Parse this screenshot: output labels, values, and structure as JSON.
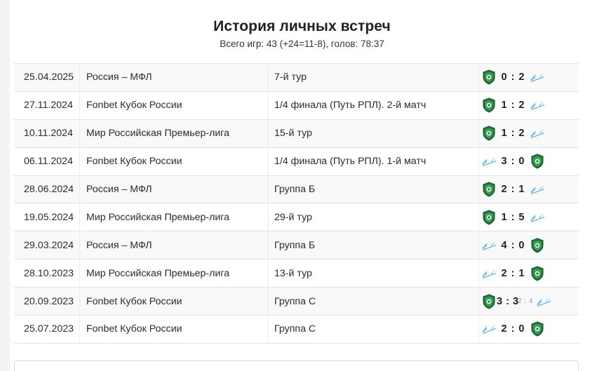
{
  "header": {
    "title": "История личных встреч",
    "subtitle": "Всего игр: 43 (+24=11-8), голов: 78:37"
  },
  "colors": {
    "akhmat_green": "#1f7a3c",
    "zenit_blue": "#6fb3e3"
  },
  "icons": {
    "home_logo_akhmat": "akhmat-logo-icon",
    "away_logo_zenit": "zenit-logo-icon"
  },
  "matches": [
    {
      "date": "25.04.2025",
      "tournament": "Россия – МФЛ",
      "stage": "7-й тур",
      "left": "akhmat",
      "score": "0 : 2",
      "penalty": "",
      "right": "zenit"
    },
    {
      "date": "27.11.2024",
      "tournament": "Fonbet Кубок России",
      "stage": "1/4 финала (Путь РПЛ). 2-й матч",
      "left": "akhmat",
      "score": "1 : 2",
      "penalty": "",
      "right": "zenit"
    },
    {
      "date": "10.11.2024",
      "tournament": "Мир Российская Премьер-лига",
      "stage": "15-й тур",
      "left": "akhmat",
      "score": "1 : 2",
      "penalty": "",
      "right": "zenit"
    },
    {
      "date": "06.11.2024",
      "tournament": "Fonbet Кубок России",
      "stage": "1/4 финала (Путь РПЛ). 1-й матч",
      "left": "zenit",
      "score": "3 : 0",
      "penalty": "",
      "right": "akhmat"
    },
    {
      "date": "28.06.2024",
      "tournament": "Россия – МФЛ",
      "stage": "Группа Б",
      "left": "akhmat",
      "score": "2 : 1",
      "penalty": "",
      "right": "zenit"
    },
    {
      "date": "19.05.2024",
      "tournament": "Мир Российская Премьер-лига",
      "stage": "29-й тур",
      "left": "akhmat",
      "score": "1 : 5",
      "penalty": "",
      "right": "zenit"
    },
    {
      "date": "29.03.2024",
      "tournament": "Россия – МФЛ",
      "stage": "Группа Б",
      "left": "zenit",
      "score": "4 : 0",
      "penalty": "",
      "right": "akhmat"
    },
    {
      "date": "28.10.2023",
      "tournament": "Мир Российская Премьер-лига",
      "stage": "13-й тур",
      "left": "zenit",
      "score": "2 : 1",
      "penalty": "",
      "right": "akhmat"
    },
    {
      "date": "20.09.2023",
      "tournament": "Fonbet Кубок России",
      "stage": "Группа С",
      "left": "akhmat",
      "score": "3 : 3",
      "penalty": "2 : 4",
      "right": "zenit"
    },
    {
      "date": "25.07.2023",
      "tournament": "Fonbet Кубок России",
      "stage": "Группа С",
      "left": "zenit",
      "score": "2 : 0",
      "penalty": "",
      "right": "akhmat"
    }
  ]
}
